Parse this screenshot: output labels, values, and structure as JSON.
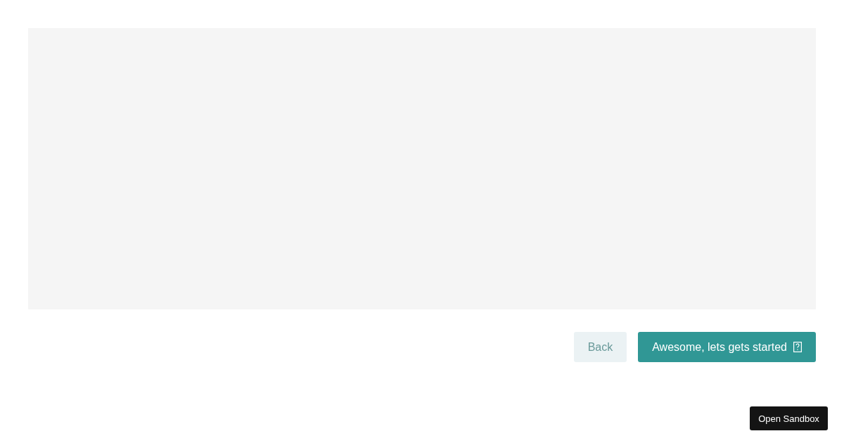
{
  "panel": {
    "kind": "empty"
  },
  "buttons": [
    {
      "label": "Back",
      "kind": "secondary"
    },
    {
      "label": "Awesome, lets gets started",
      "kind": "primary",
      "icon": true
    }
  ],
  "sandbox_button": {
    "label": "Open Sandbox"
  }
}
